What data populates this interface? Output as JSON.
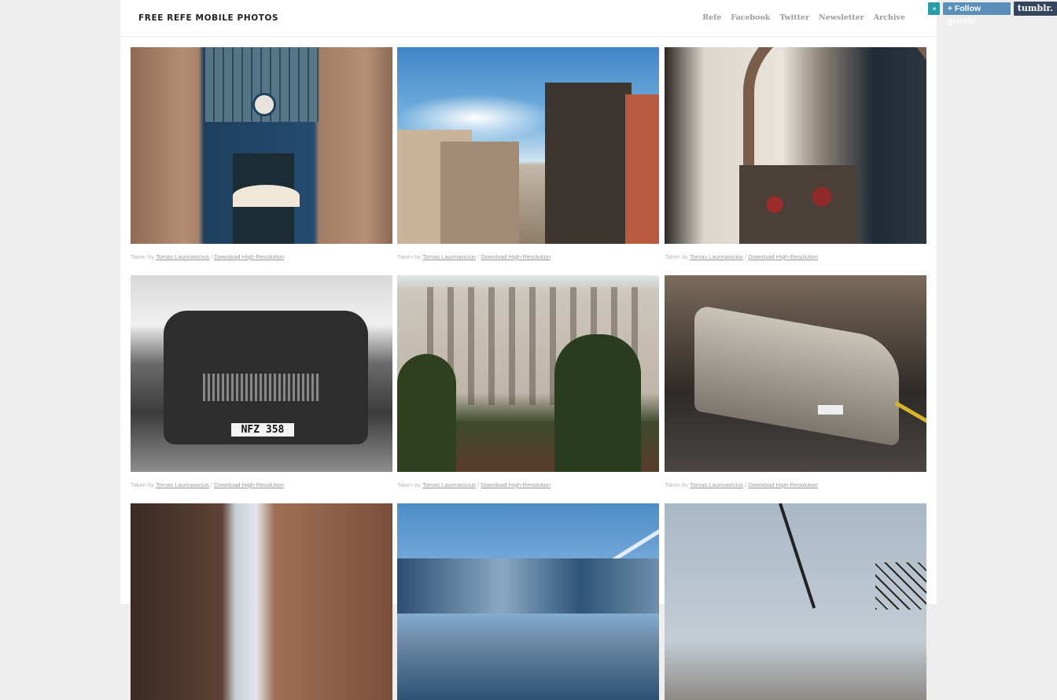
{
  "header": {
    "site_title": "FREE REFE MOBILE PHOTOS",
    "nav": [
      "Refe",
      "Facebook",
      "Twitter",
      "Newsletter",
      "Archive"
    ]
  },
  "tumblr": {
    "follow_label": "+ Follow getrefe",
    "logo_text": "tumblr."
  },
  "posts": [
    {
      "taken_by": "Taken by",
      "author": "Tomas Laurinavicius",
      "sep": "/",
      "download": "Download High-Resolution",
      "icon": "market-hall-photo"
    },
    {
      "taken_by": "Taken by",
      "author": "Tomas Laurinavicius",
      "sep": "/",
      "download": "Download High-Resolution",
      "icon": "city-buildings-photo"
    },
    {
      "taken_by": "Taken by",
      "author": "Tomas Laurinavicius",
      "sep": "/",
      "download": "Download High-Resolution",
      "icon": "arcade-cafe-photo"
    },
    {
      "taken_by": "Taken by",
      "author": "Tomas Laurinavicius",
      "sep": "/",
      "download": "Download High-Resolution",
      "icon": "mercedes-car-photo",
      "plate": "NFZ 358"
    },
    {
      "taken_by": "Taken by",
      "author": "Tomas Laurinavicius",
      "sep": "/",
      "download": "Download High-Resolution",
      "icon": "ornate-building-photo"
    },
    {
      "taken_by": "Taken by",
      "author": "Tomas Laurinavicius",
      "sep": "/",
      "download": "Download High-Resolution",
      "icon": "vintage-car-street-photo"
    },
    {
      "icon": "narrow-street-photo"
    },
    {
      "icon": "glass-building-photo"
    },
    {
      "icon": "construction-crane-photo"
    }
  ]
}
